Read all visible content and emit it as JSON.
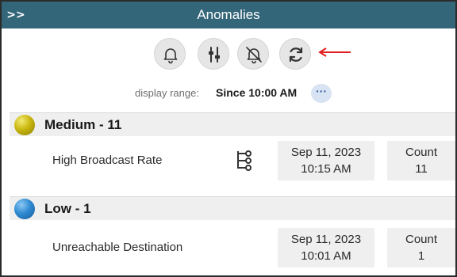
{
  "window": {
    "title": "Anomalies",
    "expand_glyph": ">>"
  },
  "toolbar": {
    "buttons": [
      {
        "icon": "bell-icon"
      },
      {
        "icon": "sliders-icon"
      },
      {
        "icon": "bell-off-icon"
      },
      {
        "icon": "refresh-icon"
      }
    ],
    "highlight_arrow_color": "#e02020"
  },
  "display_range": {
    "label": "display range:",
    "value": "Since 10:00 AM",
    "more_glyph": "···"
  },
  "groups": [
    {
      "title": "Medium - 11",
      "color": "#c9b70f",
      "rows": [
        {
          "name": "High Broadcast Rate",
          "date": "Sep 11, 2023",
          "time": "10:15 AM",
          "count_label": "Count",
          "count": "11",
          "has_hierarchy_icon": true
        }
      ]
    },
    {
      "title": "Low - 1",
      "color": "#2f8ad2",
      "rows": [
        {
          "name": "Unreachable Destination",
          "date": "Sep 11, 2023",
          "time": "10:01 AM",
          "count_label": "Count",
          "count": "1",
          "has_hierarchy_icon": false
        }
      ]
    }
  ]
}
